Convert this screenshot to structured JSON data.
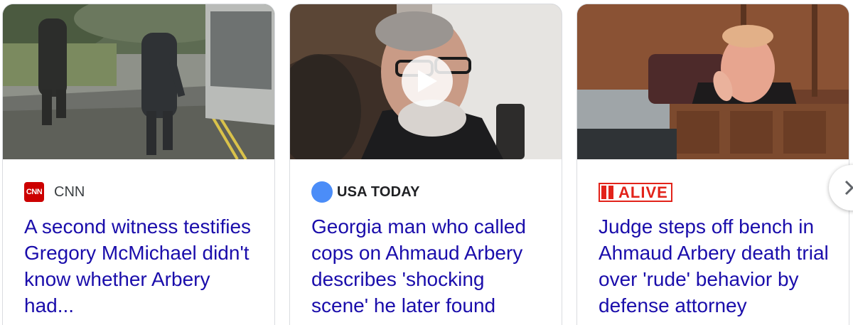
{
  "cards": [
    {
      "source": "CNN",
      "logo_text": "CNN",
      "headline": "A second witness testifies Gregory McMichael didn't know whether Arbery had..."
    },
    {
      "source": "USA TODAY",
      "headline": "Georgia man who called cops on Ahmaud Arbery describes 'shocking scene' he later found",
      "video": true
    },
    {
      "source": "ALIVE",
      "headline": "Judge steps off bench in Ahmaud Arbery death trial over 'rude' behavior by defense attorney"
    }
  ],
  "colors": {
    "headline": "#1a0dab",
    "cnn_red": "#cc0000",
    "usa_today_blue": "#4b8df8",
    "alive_red": "#e2231a"
  },
  "icons": {
    "play": "play-icon",
    "next": "chevron-right-icon"
  }
}
